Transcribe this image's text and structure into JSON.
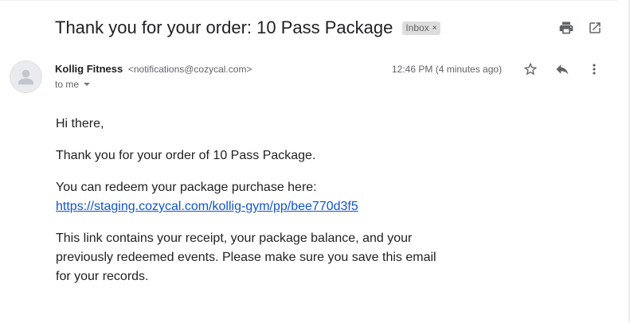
{
  "header": {
    "subject": "Thank you for your order: 10 Pass Package",
    "label": "Inbox",
    "label_remove": "×",
    "icons": [
      "print-icon",
      "open-in-new-window-icon"
    ]
  },
  "message": {
    "sender_name": "Kollig Fitness",
    "sender_email": "<notifications@cozycal.com>",
    "to": "to me",
    "timestamp": "12:46 PM (4 minutes ago)",
    "icons": [
      "star-icon",
      "reply-icon",
      "more-vert-icon"
    ]
  },
  "body": {
    "greeting": "Hi there,",
    "line1": "Thank you for your order of 10 Pass Package.",
    "line2": "You can redeem your package purchase here:",
    "link": "https://staging.cozycal.com/kollig-gym/pp/bee770d3f5",
    "line3": "This link contains your receipt, your package balance, and your previously redeemed events. Please make sure you save this email for your records."
  },
  "colors": {
    "link": "#1155cc",
    "label_bg": "#dddddd",
    "muted_text": "#5f6368"
  }
}
